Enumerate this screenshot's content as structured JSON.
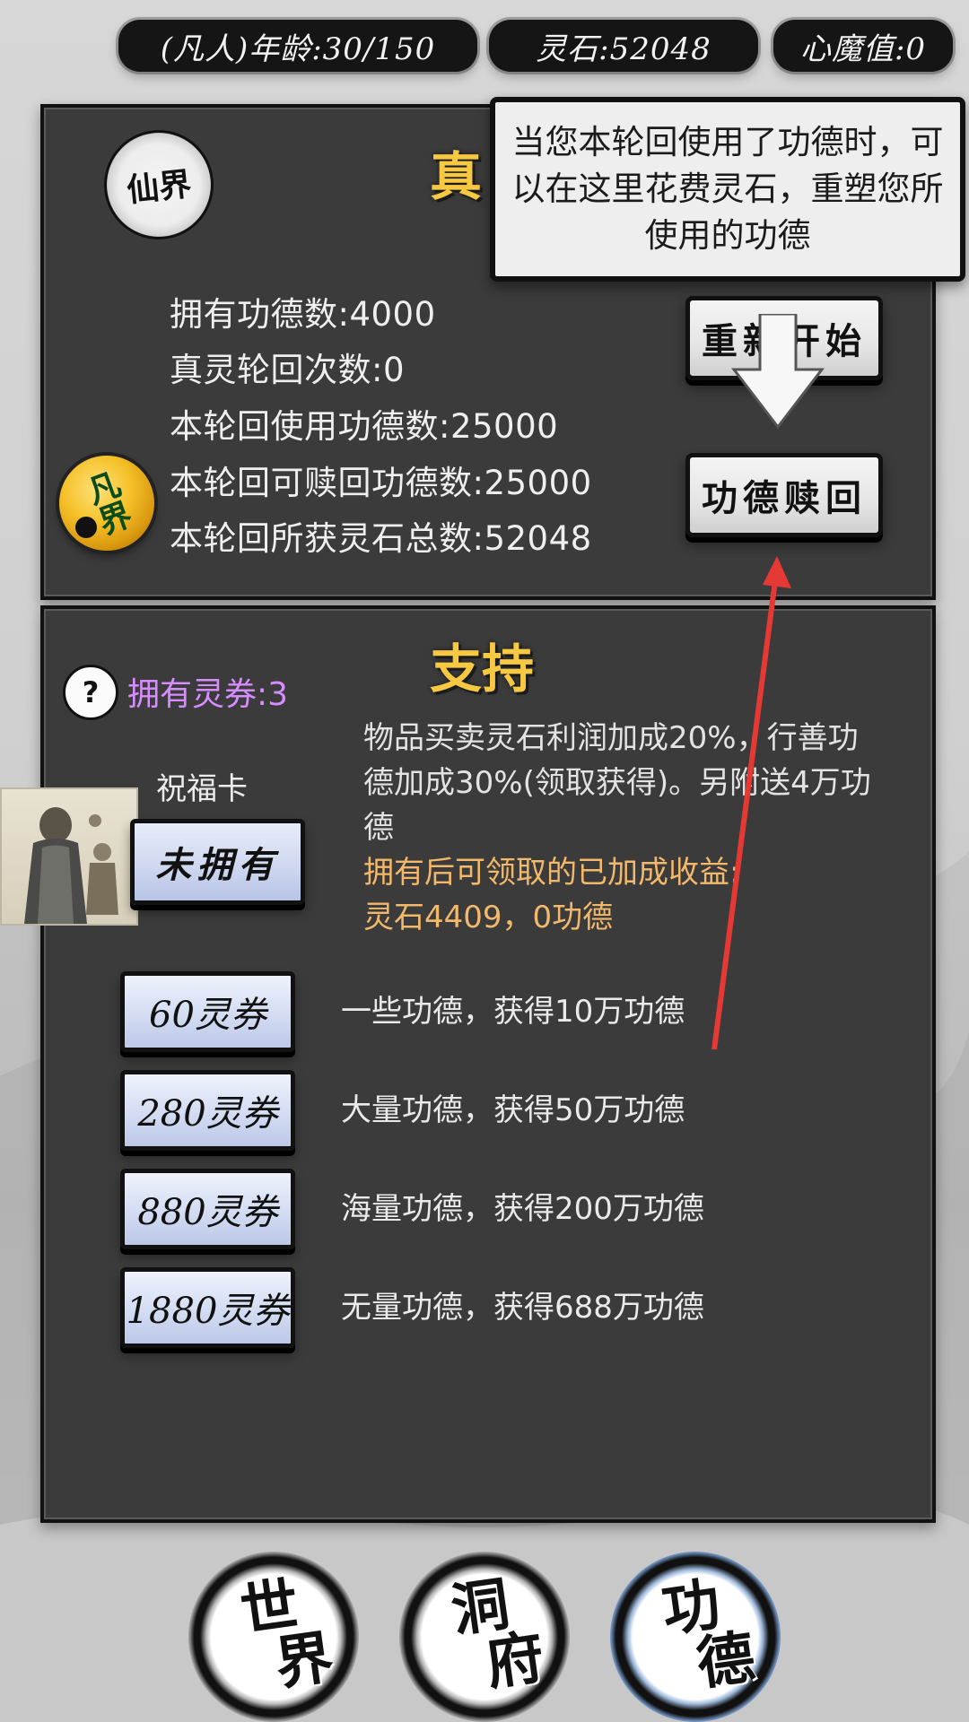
{
  "topbar": {
    "age_label": "(凡人)年龄:30/150",
    "spirit_stone_label": "灵石:52048",
    "heart_demon_label": "心魔值:0"
  },
  "top_panel": {
    "title": "真",
    "badge_label": "仙界",
    "orb_label": "凡界",
    "stats": [
      "拥有功德数:4000",
      "真灵轮回次数:0",
      "本轮回使用功德数:25000",
      "本轮回可赎回功德数:25000",
      "本轮回所获灵石总数:52048"
    ],
    "restart_button": "重新开始",
    "redeem_button": "功德赎回"
  },
  "tooltip": {
    "text": "当您本轮回使用了功德时，可以在这里花费灵石，重塑您所使用的功德"
  },
  "support_panel": {
    "title": "支持",
    "help_icon": "?",
    "ticket_count_label": "拥有灵券:3",
    "blessing_card_label": "祝福卡",
    "not_owned_button": "未拥有",
    "description": "物品买卖灵石利润加成20%，行善功德加成30%(领取获得)。另附送4万功德",
    "reward_heading": "拥有后可领取的已加成收益:",
    "reward_values": "灵石4409，0功德",
    "packages": [
      {
        "button": "60灵券",
        "desc": "一些功德，获得10万功德"
      },
      {
        "button": "280灵券",
        "desc": "大量功德，获得50万功德"
      },
      {
        "button": "880灵券",
        "desc": "海量功德，获得200万功德"
      },
      {
        "button": "1880灵券",
        "desc": "无量功德，获得688万功德"
      }
    ]
  },
  "bottom_nav": {
    "items": [
      {
        "top": "世",
        "bottom": "界",
        "active": false
      },
      {
        "top": "洞",
        "bottom": "府",
        "active": false
      },
      {
        "top": "功",
        "bottom": "德",
        "active": true
      }
    ]
  },
  "colors": {
    "panel_bg": "#3b3b3b",
    "title_gold": "#f7c842",
    "ticket_purple": "#d78cff",
    "reward_orange": "#f2b86b",
    "arrow_red": "#e53935",
    "active_nav_blue": "#9db8dd"
  },
  "icons": {
    "help": "question-circle-icon",
    "tooltip_pointer": "down-arrow-icon",
    "annotation": "red-arrow-icon"
  }
}
